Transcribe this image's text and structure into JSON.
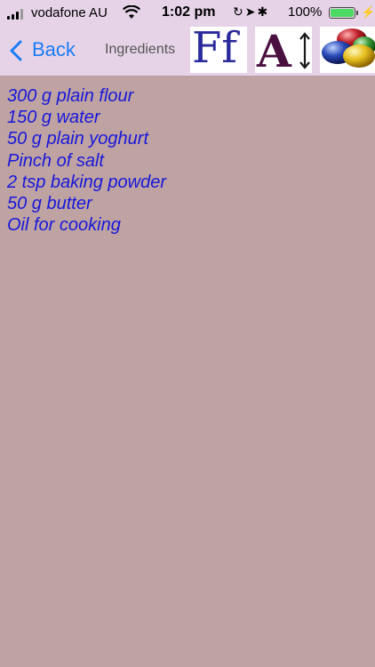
{
  "status_bar": {
    "carrier": "vodafone AU",
    "time": "1:02 pm",
    "battery": "100%"
  },
  "nav": {
    "back_label": "Back",
    "title": "Ingredients",
    "font_button_text": "Ff",
    "size_button_text": "A",
    "color_button_icon": "color-balls-icon"
  },
  "colors": {
    "nav_background": "#e6d3e8",
    "page_background": "#bfa2a2",
    "text_color": "#1818d8",
    "back_color": "#1a7cf5"
  },
  "ingredients": [
    "300 g plain flour",
    "150 g water",
    "50 g plain yoghurt",
    "Pinch of salt",
    "2 tsp baking powder",
    "50 g butter",
    "Oil for cooking"
  ]
}
